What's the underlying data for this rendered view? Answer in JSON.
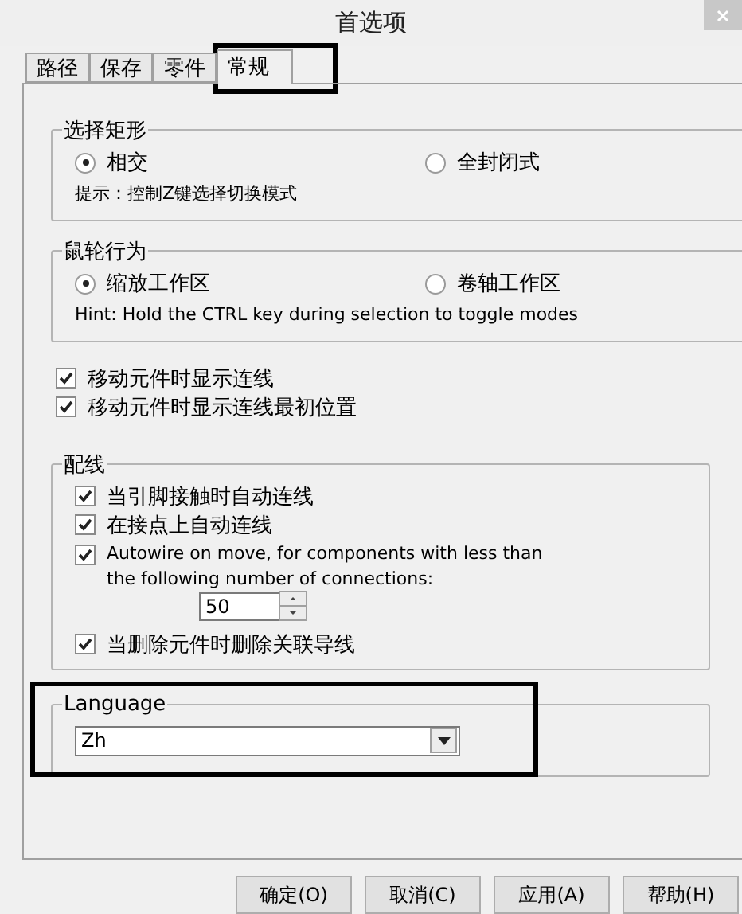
{
  "window": {
    "title": "首选项"
  },
  "tabs": [
    {
      "label": "路径",
      "selected": false,
      "highlighted": false
    },
    {
      "label": "保存",
      "selected": false,
      "highlighted": false
    },
    {
      "label": "零件",
      "selected": false,
      "highlighted": false
    },
    {
      "label": "常规",
      "selected": true,
      "highlighted": true
    }
  ],
  "selection_rect": {
    "title": "选择矩形",
    "options": [
      {
        "label": "相交",
        "selected": true
      },
      {
        "label": "全封闭式",
        "selected": false
      }
    ],
    "hint": "提示：控制Z键选择切换模式"
  },
  "wheel": {
    "title": "鼠轮行为",
    "options": [
      {
        "label": "缩放工作区",
        "selected": true
      },
      {
        "label": "卷轴工作区",
        "selected": false
      }
    ],
    "hint": "Hint: Hold the CTRL key during selection to toggle modes"
  },
  "checks": [
    {
      "label": "移动元件时显示连线",
      "checked": true
    },
    {
      "label": "移动元件时显示连线最初位置",
      "checked": true
    }
  ],
  "wiring": {
    "title": "配线",
    "items": [
      {
        "kind": "check",
        "label": "当引脚接触时自动连线",
        "checked": true
      },
      {
        "kind": "check",
        "label": "在接点上自动连线",
        "checked": true
      },
      {
        "kind": "autowire",
        "label": "Autowire on move, for components with less than",
        "label2": "the following number of connections:",
        "checked": true,
        "value": "50"
      },
      {
        "kind": "check",
        "label": "当删除元件时删除关联导线",
        "checked": true
      }
    ]
  },
  "language": {
    "title": "Language",
    "value": "Zh",
    "highlighted": true
  },
  "buttons": [
    "确定(O)",
    "取消(C)",
    "应用(A)",
    "帮助(H)"
  ]
}
